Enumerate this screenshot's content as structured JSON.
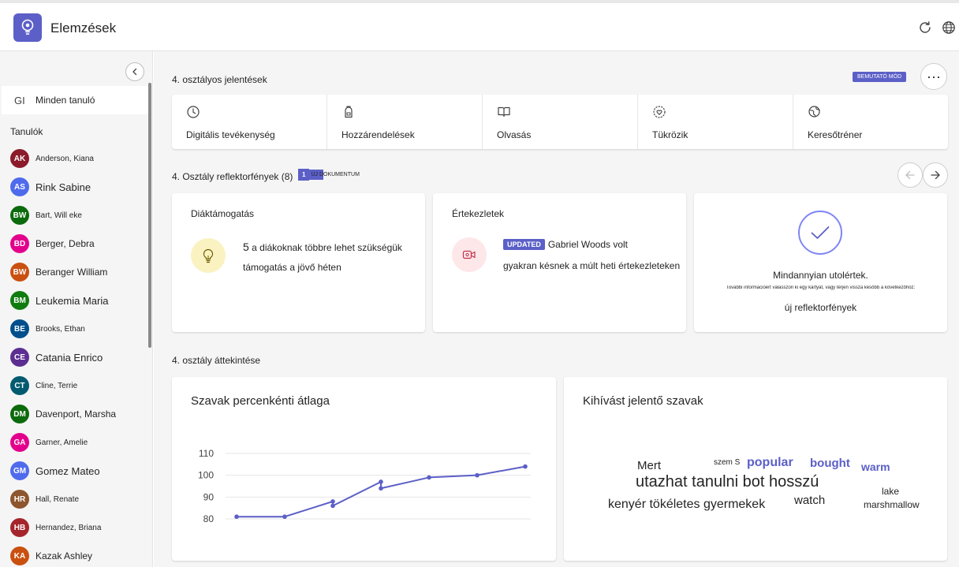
{
  "app": {
    "title": "Elemzések",
    "accent": "#5b5fc7"
  },
  "sidebar": {
    "all_students": {
      "initials": "GI",
      "label": "Minden tanuló"
    },
    "students_label": "Tanulók",
    "students": [
      {
        "initials": "AK",
        "name": "Anderson, Kiana",
        "color": "#8b1a2b",
        "size": 10
      },
      {
        "initials": "AS",
        "name": "Rink Sabine",
        "color": "#4f6bed",
        "size": 13
      },
      {
        "initials": "BW",
        "name": "Bart, Will eke",
        "color": "#0b6a0b",
        "size": 10
      },
      {
        "initials": "BD",
        "name": "Berger, Debra",
        "color": "#e3008c",
        "size": 12
      },
      {
        "initials": "BW",
        "name": "Beranger William",
        "color": "#ca5010",
        "size": 12
      },
      {
        "initials": "BM",
        "name": "Leukemia Maria",
        "color": "#107c10",
        "size": 13
      },
      {
        "initials": "BE",
        "name": "Brooks, Ethan",
        "color": "#004e8c",
        "size": 10
      },
      {
        "initials": "CE",
        "name": "Catania Enrico",
        "color": "#5c2e91",
        "size": 13
      },
      {
        "initials": "CT",
        "name": "Cline, Terrie",
        "color": "#005b70",
        "size": 10
      },
      {
        "initials": "DM",
        "name": "Davenport, Marsha",
        "color": "#0b6a0b",
        "size": 12
      },
      {
        "initials": "GA",
        "name": "Garner, Amelie",
        "color": "#e3008c",
        "size": 10
      },
      {
        "initials": "GM",
        "name": "Gomez Mateo",
        "color": "#4f6bed",
        "size": 13
      },
      {
        "initials": "HR",
        "name": "Hall, Renate",
        "color": "#8e562e",
        "size": 10
      },
      {
        "initials": "HB",
        "name": "Hernandez, Briana",
        "color": "#a4262c",
        "size": 10
      },
      {
        "initials": "KA",
        "name": "Kazak Ashley",
        "color": "#ca5010",
        "size": 12
      }
    ]
  },
  "main": {
    "reports_title": "4. osztályos jelentések",
    "demo_badge": "BEMUTATÓ MÓD",
    "more_label": "···",
    "tiles": [
      {
        "label": "Digitális tevékenység",
        "icon": "clock-icon"
      },
      {
        "label": "Hozzárendelések",
        "icon": "backpack-icon"
      },
      {
        "label": "Olvasás",
        "icon": "book-icon"
      },
      {
        "label": "Tükrözik",
        "icon": "heart-circle-icon"
      },
      {
        "label": "Keresőtréner",
        "icon": "globe-search-icon"
      }
    ],
    "spotlights_title": "4. Osztály reflektorfények (8)",
    "new_doc_count": "1",
    "new_doc_label": "ÚJ DOKUMENTUM",
    "cards": {
      "support": {
        "title": "Diáktámogatás",
        "line1_num": "5",
        "line1": "a diákoknak többre lehet szükségük",
        "line2": "támogatás a jövő héten"
      },
      "meetings": {
        "title": "Értekezletek",
        "badge": "UPDATED",
        "line1": "Gabriel Woods volt",
        "line2": "gyakran késnek a múlt heti értekezleteken"
      },
      "caught_up": {
        "title": "Mindannyian utolértek.",
        "sub": "További információért válasszon ki egy kártyát, vagy térjen vissza később a következőhöz:",
        "link": "új reflektorfények"
      }
    },
    "overview_title": "4. osztály áttekintése",
    "wpm_title": "Szavak percenkénti átlaga",
    "words_title": "Kihívást jelentő szavak"
  },
  "chart_data": {
    "type": "line",
    "title": "Szavak percenkénti átlaga",
    "xlabel": "",
    "ylabel": "",
    "y_ticks": [
      80,
      90,
      100,
      110
    ],
    "ylim": [
      80,
      110
    ],
    "x": [
      1,
      2,
      3,
      3,
      4,
      4,
      5,
      6,
      7
    ],
    "y": [
      81,
      81,
      88,
      86,
      97,
      94,
      99,
      100,
      104
    ],
    "grid": true,
    "color": "#5b5fc7"
  },
  "word_cloud": [
    {
      "text": "Mert",
      "size": 15,
      "color": "#242424",
      "weight": "normal"
    },
    {
      "text": "szem S",
      "size": 10,
      "color": "#242424",
      "weight": "normal"
    },
    {
      "text": "popular",
      "size": 16,
      "color": "#5b5fc7",
      "weight": "bold"
    },
    {
      "text": "bought",
      "size": 15,
      "color": "#5b5fc7",
      "weight": "bold"
    },
    {
      "text": "warm",
      "size": 14,
      "color": "#5b5fc7",
      "weight": "bold"
    },
    {
      "text": "utazhat tanulni bot hosszú",
      "size": 20,
      "color": "#242424",
      "weight": "normal"
    },
    {
      "text": "lake",
      "size": 12,
      "color": "#242424",
      "weight": "normal"
    },
    {
      "text": "kenyér tökéletes gyermekek",
      "size": 16,
      "color": "#242424",
      "weight": "normal"
    },
    {
      "text": "watch",
      "size": 15,
      "color": "#242424",
      "weight": "normal"
    },
    {
      "text": "marshmallow",
      "size": 12,
      "color": "#242424",
      "weight": "normal"
    }
  ]
}
